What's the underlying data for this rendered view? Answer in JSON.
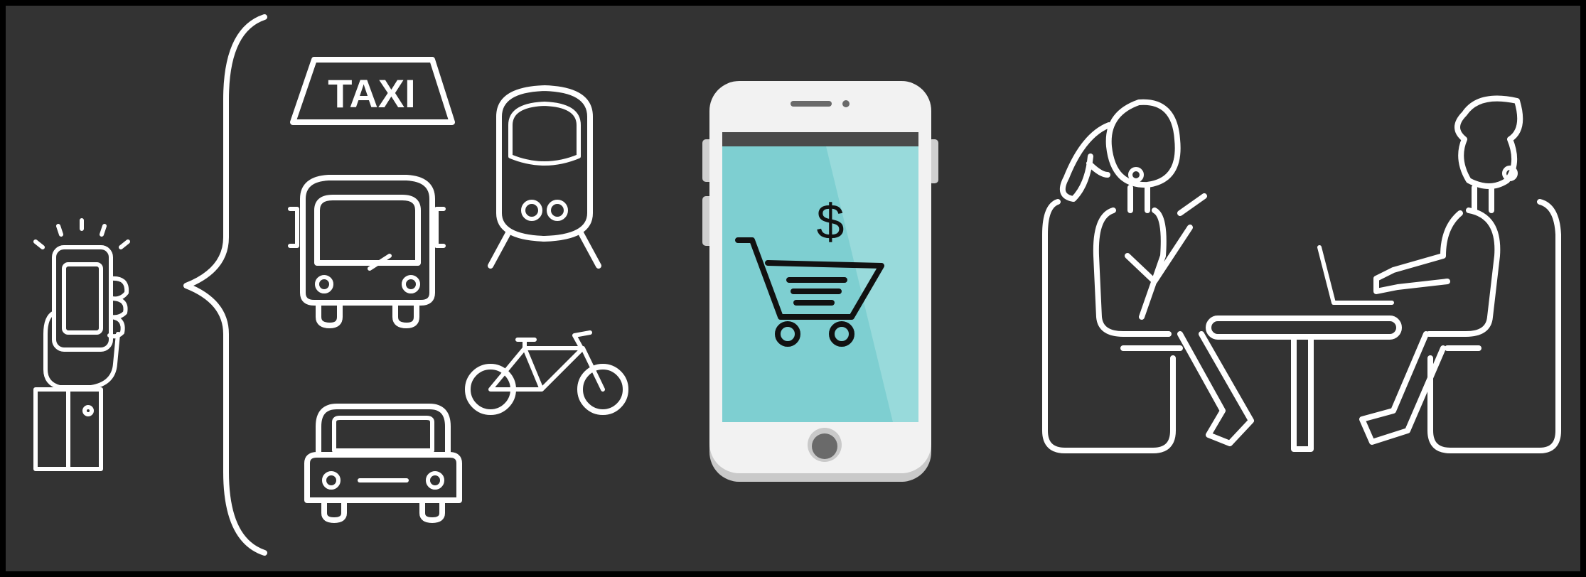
{
  "colors": {
    "frame": "#000000",
    "background": "#333333",
    "stroke": "#ffffff",
    "phone_body": "#f2f2f2",
    "phone_edge": "#c9c9c9",
    "phone_screen": "#7ecfd1",
    "phone_screen_bar": "#4a4a4a",
    "cart_ink": "#111111"
  },
  "icons": {
    "hand_phone": "hand-holding-phone-icon",
    "taxi": "taxi-sign-icon",
    "bus": "bus-icon",
    "train": "train-icon",
    "bike": "bicycle-icon",
    "car": "car-icon",
    "phone": "smartphone-icon",
    "cart": "shopping-cart-icon",
    "woman": "woman-seated-icon",
    "man": "man-seated-laptop-icon",
    "table": "table-icon",
    "laptop": "laptop-icon"
  },
  "labels": {
    "taxi": "TAXI",
    "currency": "$"
  }
}
